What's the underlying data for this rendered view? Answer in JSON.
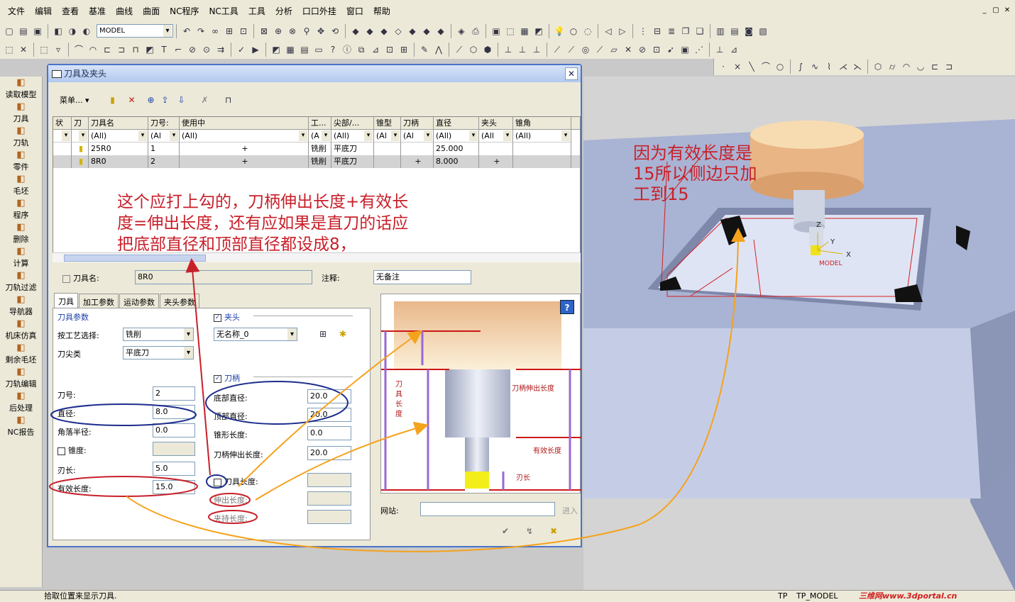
{
  "menu": [
    "文件",
    "编辑",
    "查看",
    "基准",
    "曲线",
    "曲面",
    "NC程序",
    "NC工具",
    "工具",
    "分析",
    "口口外挂",
    "窗口",
    "帮助"
  ],
  "window_buttons": [
    "_",
    "▢",
    "✕"
  ],
  "toolbar": {
    "model_select": "MODEL"
  },
  "left_nav": [
    "读取模型",
    "刀具",
    "刀轨",
    "零件",
    "毛坯",
    "程序",
    "删除",
    "计算",
    "刀轨过滤",
    "导航器",
    "机床仿真",
    "剩余毛坯",
    "刀轨编辑",
    "后处理",
    "NC报告"
  ],
  "dialog": {
    "title": "刀具及夹头",
    "menu_button": "菜单...",
    "table": {
      "headers": [
        "状",
        "刀",
        "刀具名",
        "刀号:",
        "使用中",
        "工...",
        "尖部/...",
        "锥型",
        "刀柄",
        "直径",
        "夹头",
        "锥角"
      ],
      "filters": [
        "",
        "",
        "(All)",
        "(Al",
        "(All)",
        "(A",
        "(All)",
        "(Al",
        "(Al",
        "(All)",
        "(All",
        "(All)"
      ],
      "rows": [
        [
          "",
          "▮",
          "25R0",
          "1",
          "+",
          "铣削",
          "平底刀",
          "",
          "",
          "25.000",
          "",
          ""
        ],
        [
          "",
          "▮",
          "8R0",
          "2",
          "+",
          "铣削",
          "平底刀",
          "",
          "+",
          "8.000",
          "+",
          ""
        ]
      ]
    },
    "tool_name_label": "刀具名:",
    "tool_name_value": "8R0",
    "comment_label": "注释:",
    "comment_value": "无备注",
    "tabs": [
      "刀具",
      "加工参数",
      "运动参数",
      "夹头参数"
    ],
    "section_tool_params": "刀具参数",
    "process_label": "按工艺选择:",
    "process_value": "铣削",
    "tip_label": "刀尖类",
    "tip_value": "平底刀",
    "tool_no_label": "刀号:",
    "tool_no_value": "2",
    "diameter_label": "直径:",
    "diameter_value": "8.0",
    "corner_label": "角落半径:",
    "corner_value": "0.0",
    "taper_label": "锥度:",
    "taper_value": "",
    "flute_label": "刃长:",
    "flute_value": "5.0",
    "effective_label": "有效长度:",
    "effective_value": "15.0",
    "holder_section": "夹头",
    "holder_value": "无名称_0",
    "shank_section": "刀柄",
    "bottom_dia_label": "底部直径:",
    "bottom_dia_value": "20.0",
    "top_dia_label": "顶部直径:",
    "top_dia_value": "20.0",
    "taper_len_label": "锥形长度:",
    "taper_len_value": "0.0",
    "shank_out_label": "刀柄伸出长度:",
    "shank_out_value": "20.0",
    "tool_len_label": "刀具长度:",
    "out_len_label": "伸出长度:",
    "hold_len_label": "夹持长度:",
    "website_label": "网站:",
    "goto_label": "进入",
    "diag_labels": {
      "tool_length": "刀\n具\n长\n度",
      "shank_out": "刀柄伸出长度",
      "effective": "有效长度",
      "flute": "刃长"
    }
  },
  "annotations": {
    "note1": [
      "这个应打上勾的，刀柄伸出长度+有效长",
      "度=伸出长度，还有应如果是直刀的话应",
      "把底部直径和顶部直径都设成8，"
    ],
    "note2": [
      "因为有效长度是",
      "15所以侧边只加",
      "工到15"
    ]
  },
  "viewport": {
    "model_label": "MODEL",
    "axis_x": "X",
    "axis_y": "Y",
    "axis_z": "Z"
  },
  "status": {
    "message": "拾取位置来显示刀具.",
    "tp": "TP",
    "model": "TP_MODEL",
    "watermark": "三维网www.3dportal.cn"
  },
  "colors": {
    "annotation": "#c8202a",
    "arrow": "#f5a21c",
    "ellipse_blue": "#1d2d8c",
    "ellipse_red": "#c8202a"
  }
}
